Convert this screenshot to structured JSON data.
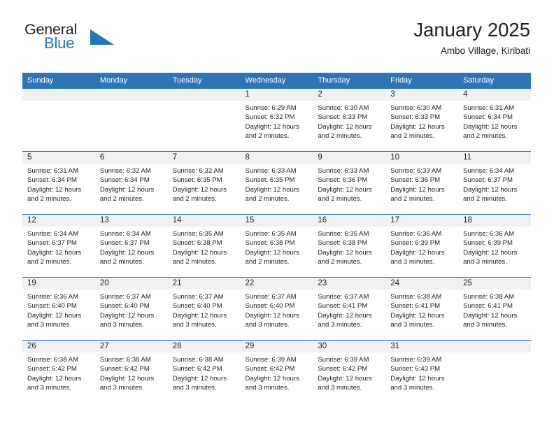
{
  "brand": {
    "name_top": "General",
    "name_bottom": "Blue",
    "accent_color": "#1f76bd",
    "triangle_icon": "triangle-icon"
  },
  "header": {
    "title": "January 2025",
    "subtitle": "Ambo Village, Kiribati"
  },
  "colors": {
    "header_blue": "#2e75b6",
    "daynum_band": "#f1f1f1",
    "text": "#231f20"
  },
  "weekday_headers": [
    "Sunday",
    "Monday",
    "Tuesday",
    "Wednesday",
    "Thursday",
    "Friday",
    "Saturday"
  ],
  "weeks": [
    [
      {
        "day": "",
        "sunrise": "",
        "sunset": "",
        "daylight1": "",
        "daylight2": ""
      },
      {
        "day": "",
        "sunrise": "",
        "sunset": "",
        "daylight1": "",
        "daylight2": ""
      },
      {
        "day": "",
        "sunrise": "",
        "sunset": "",
        "daylight1": "",
        "daylight2": ""
      },
      {
        "day": "1",
        "sunrise": "Sunrise: 6:29 AM",
        "sunset": "Sunset: 6:32 PM",
        "daylight1": "Daylight: 12 hours",
        "daylight2": "and 2 minutes."
      },
      {
        "day": "2",
        "sunrise": "Sunrise: 6:30 AM",
        "sunset": "Sunset: 6:33 PM",
        "daylight1": "Daylight: 12 hours",
        "daylight2": "and 2 minutes."
      },
      {
        "day": "3",
        "sunrise": "Sunrise: 6:30 AM",
        "sunset": "Sunset: 6:33 PM",
        "daylight1": "Daylight: 12 hours",
        "daylight2": "and 2 minutes."
      },
      {
        "day": "4",
        "sunrise": "Sunrise: 6:31 AM",
        "sunset": "Sunset: 6:34 PM",
        "daylight1": "Daylight: 12 hours",
        "daylight2": "and 2 minutes."
      }
    ],
    [
      {
        "day": "5",
        "sunrise": "Sunrise: 6:31 AM",
        "sunset": "Sunset: 6:34 PM",
        "daylight1": "Daylight: 12 hours",
        "daylight2": "and 2 minutes."
      },
      {
        "day": "6",
        "sunrise": "Sunrise: 6:32 AM",
        "sunset": "Sunset: 6:34 PM",
        "daylight1": "Daylight: 12 hours",
        "daylight2": "and 2 minutes."
      },
      {
        "day": "7",
        "sunrise": "Sunrise: 6:32 AM",
        "sunset": "Sunset: 6:35 PM",
        "daylight1": "Daylight: 12 hours",
        "daylight2": "and 2 minutes."
      },
      {
        "day": "8",
        "sunrise": "Sunrise: 6:33 AM",
        "sunset": "Sunset: 6:35 PM",
        "daylight1": "Daylight: 12 hours",
        "daylight2": "and 2 minutes."
      },
      {
        "day": "9",
        "sunrise": "Sunrise: 6:33 AM",
        "sunset": "Sunset: 6:36 PM",
        "daylight1": "Daylight: 12 hours",
        "daylight2": "and 2 minutes."
      },
      {
        "day": "10",
        "sunrise": "Sunrise: 6:33 AM",
        "sunset": "Sunset: 6:36 PM",
        "daylight1": "Daylight: 12 hours",
        "daylight2": "and 2 minutes."
      },
      {
        "day": "11",
        "sunrise": "Sunrise: 6:34 AM",
        "sunset": "Sunset: 6:37 PM",
        "daylight1": "Daylight: 12 hours",
        "daylight2": "and 2 minutes."
      }
    ],
    [
      {
        "day": "12",
        "sunrise": "Sunrise: 6:34 AM",
        "sunset": "Sunset: 6:37 PM",
        "daylight1": "Daylight: 12 hours",
        "daylight2": "and 2 minutes."
      },
      {
        "day": "13",
        "sunrise": "Sunrise: 6:34 AM",
        "sunset": "Sunset: 6:37 PM",
        "daylight1": "Daylight: 12 hours",
        "daylight2": "and 2 minutes."
      },
      {
        "day": "14",
        "sunrise": "Sunrise: 6:35 AM",
        "sunset": "Sunset: 6:38 PM",
        "daylight1": "Daylight: 12 hours",
        "daylight2": "and 2 minutes."
      },
      {
        "day": "15",
        "sunrise": "Sunrise: 6:35 AM",
        "sunset": "Sunset: 6:38 PM",
        "daylight1": "Daylight: 12 hours",
        "daylight2": "and 2 minutes."
      },
      {
        "day": "16",
        "sunrise": "Sunrise: 6:35 AM",
        "sunset": "Sunset: 6:38 PM",
        "daylight1": "Daylight: 12 hours",
        "daylight2": "and 2 minutes."
      },
      {
        "day": "17",
        "sunrise": "Sunrise: 6:36 AM",
        "sunset": "Sunset: 6:39 PM",
        "daylight1": "Daylight: 12 hours",
        "daylight2": "and 3 minutes."
      },
      {
        "day": "18",
        "sunrise": "Sunrise: 6:36 AM",
        "sunset": "Sunset: 6:39 PM",
        "daylight1": "Daylight: 12 hours",
        "daylight2": "and 3 minutes."
      }
    ],
    [
      {
        "day": "19",
        "sunrise": "Sunrise: 6:36 AM",
        "sunset": "Sunset: 6:40 PM",
        "daylight1": "Daylight: 12 hours",
        "daylight2": "and 3 minutes."
      },
      {
        "day": "20",
        "sunrise": "Sunrise: 6:37 AM",
        "sunset": "Sunset: 6:40 PM",
        "daylight1": "Daylight: 12 hours",
        "daylight2": "and 3 minutes."
      },
      {
        "day": "21",
        "sunrise": "Sunrise: 6:37 AM",
        "sunset": "Sunset: 6:40 PM",
        "daylight1": "Daylight: 12 hours",
        "daylight2": "and 3 minutes."
      },
      {
        "day": "22",
        "sunrise": "Sunrise: 6:37 AM",
        "sunset": "Sunset: 6:40 PM",
        "daylight1": "Daylight: 12 hours",
        "daylight2": "and 3 minutes."
      },
      {
        "day": "23",
        "sunrise": "Sunrise: 6:37 AM",
        "sunset": "Sunset: 6:41 PM",
        "daylight1": "Daylight: 12 hours",
        "daylight2": "and 3 minutes."
      },
      {
        "day": "24",
        "sunrise": "Sunrise: 6:38 AM",
        "sunset": "Sunset: 6:41 PM",
        "daylight1": "Daylight: 12 hours",
        "daylight2": "and 3 minutes."
      },
      {
        "day": "25",
        "sunrise": "Sunrise: 6:38 AM",
        "sunset": "Sunset: 6:41 PM",
        "daylight1": "Daylight: 12 hours",
        "daylight2": "and 3 minutes."
      }
    ],
    [
      {
        "day": "26",
        "sunrise": "Sunrise: 6:38 AM",
        "sunset": "Sunset: 6:42 PM",
        "daylight1": "Daylight: 12 hours",
        "daylight2": "and 3 minutes."
      },
      {
        "day": "27",
        "sunrise": "Sunrise: 6:38 AM",
        "sunset": "Sunset: 6:42 PM",
        "daylight1": "Daylight: 12 hours",
        "daylight2": "and 3 minutes."
      },
      {
        "day": "28",
        "sunrise": "Sunrise: 6:38 AM",
        "sunset": "Sunset: 6:42 PM",
        "daylight1": "Daylight: 12 hours",
        "daylight2": "and 3 minutes."
      },
      {
        "day": "29",
        "sunrise": "Sunrise: 6:39 AM",
        "sunset": "Sunset: 6:42 PM",
        "daylight1": "Daylight: 12 hours",
        "daylight2": "and 3 minutes."
      },
      {
        "day": "30",
        "sunrise": "Sunrise: 6:39 AM",
        "sunset": "Sunset: 6:42 PM",
        "daylight1": "Daylight: 12 hours",
        "daylight2": "and 3 minutes."
      },
      {
        "day": "31",
        "sunrise": "Sunrise: 6:39 AM",
        "sunset": "Sunset: 6:43 PM",
        "daylight1": "Daylight: 12 hours",
        "daylight2": "and 3 minutes."
      },
      {
        "day": "",
        "sunrise": "",
        "sunset": "",
        "daylight1": "",
        "daylight2": ""
      }
    ]
  ]
}
